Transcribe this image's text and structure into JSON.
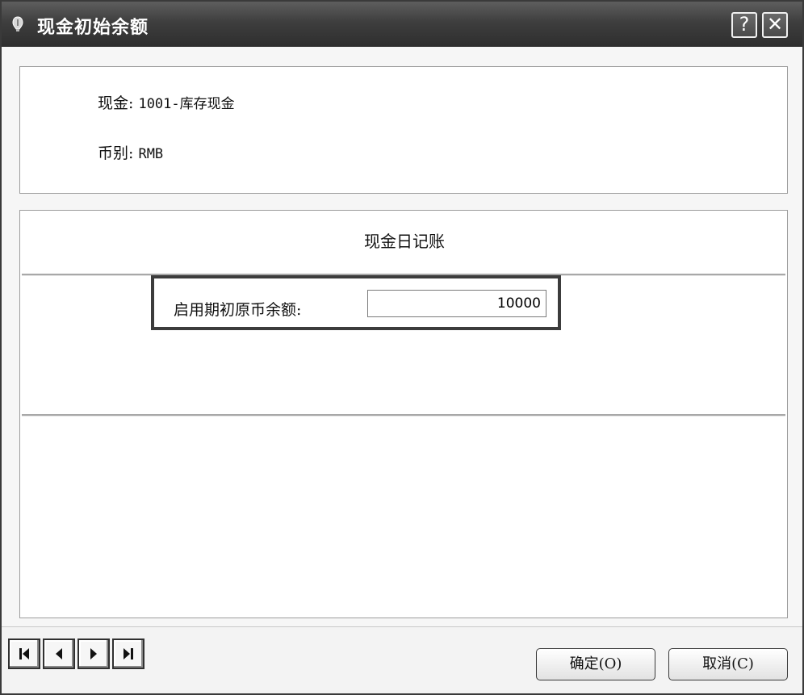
{
  "window": {
    "title": "现金初始余额",
    "help_label": "?",
    "close_label": "✕"
  },
  "info": {
    "cash_label": "现金:",
    "cash_value": "1001-库存现金",
    "currency_label": "币别:",
    "currency_value": "RMB"
  },
  "journal": {
    "title": "现金日记账",
    "opening_balance_label": "启用期初原币余额:",
    "opening_balance_value": "10000"
  },
  "navigation": {
    "first_icon": "first-record-icon",
    "prev_icon": "previous-record-icon",
    "next_icon": "next-record-icon",
    "last_icon": "last-record-icon"
  },
  "actions": {
    "ok_label": "确定(O)",
    "cancel_label": "取消(C)"
  }
}
